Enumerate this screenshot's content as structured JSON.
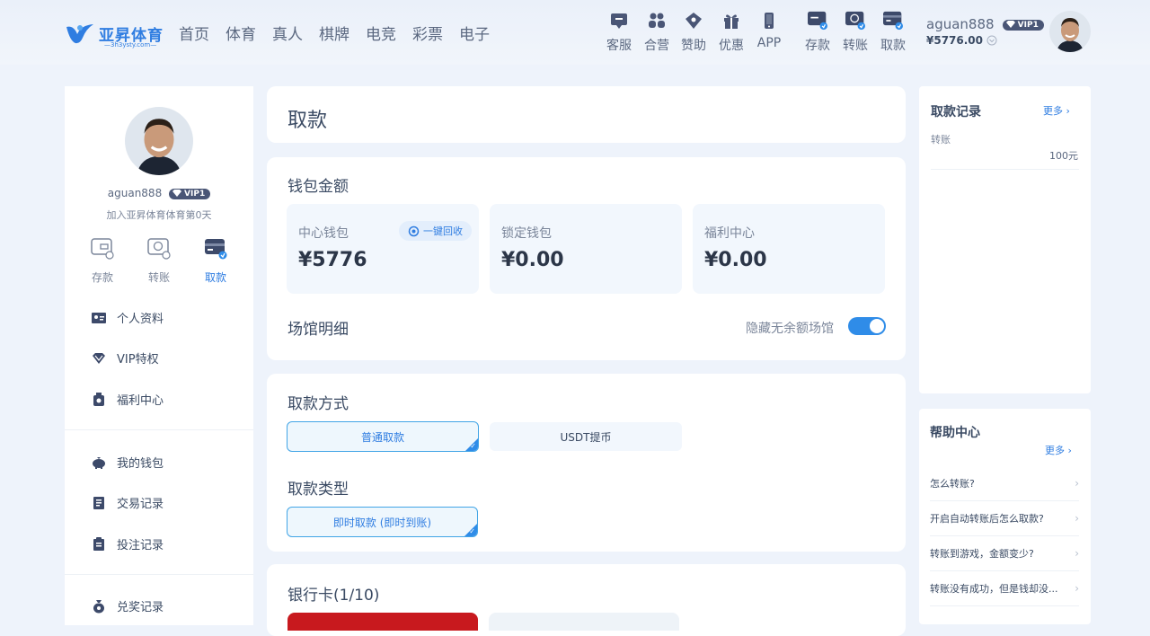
{
  "brand": {
    "name": "亚昇体育",
    "url": "—3h3ysty.com—"
  },
  "nav": [
    "首页",
    "体育",
    "真人",
    "棋牌",
    "电竞",
    "彩票",
    "电子"
  ],
  "quick_links": [
    "客服",
    "合营",
    "赞助",
    "优惠",
    "APP"
  ],
  "wallet_actions": [
    "存款",
    "转账",
    "取款"
  ],
  "user": {
    "username": "aguan888",
    "vip": "VIP1",
    "balance": "¥5776.00",
    "joined": "加入亚昇体育体育第0天"
  },
  "sidebar": {
    "actions": [
      "存款",
      "转账",
      "取款"
    ],
    "menu": [
      "个人资料",
      "VIP特权",
      "福利中心",
      "我的钱包",
      "交易记录",
      "投注记录",
      "兑奖记录"
    ]
  },
  "page_title": "取款",
  "wallet": {
    "title": "钱包金额",
    "center_label": "中心钱包",
    "center_value": "¥5776",
    "recycle": "一键回收",
    "locked_label": "锁定钱包",
    "locked_value": "¥0.00",
    "welfare_label": "福利中心",
    "welfare_value": "¥0.00",
    "venue": "场馆明细",
    "hide_toggle": "隐藏无余额场馆"
  },
  "withdraw": {
    "method_title": "取款方式",
    "method_normal": "普通取款",
    "method_usdt": "USDT提币",
    "type_title": "取款类型",
    "type_instant": "即时取款 (即时到账)"
  },
  "bank": {
    "title": "银行卡(1/10)"
  },
  "records": {
    "title": "取款记录",
    "more": "更多",
    "item_label": "转账",
    "item_amount": "100元"
  },
  "help": {
    "title": "帮助中心",
    "more": "更多",
    "questions": [
      "怎么转账?",
      "开启自动转账后怎么取款?",
      "转账到游戏，金额变少?",
      "转账没有成功，但是钱却没..."
    ]
  },
  "colors": {
    "accent": "#2f7de1",
    "toggle": "#2f8ce8",
    "bank_card": "#c8191e",
    "page_bg": "#eef3fb"
  }
}
